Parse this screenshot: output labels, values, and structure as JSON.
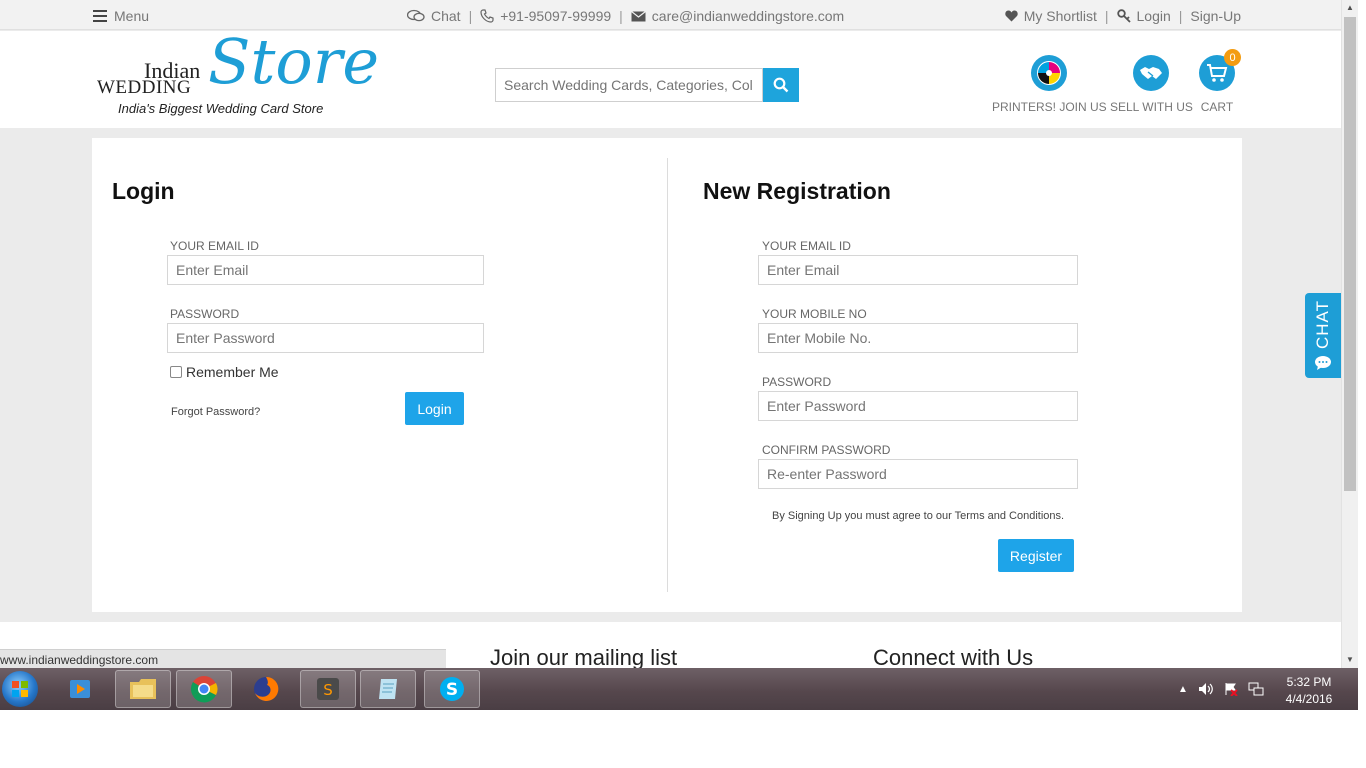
{
  "topbar": {
    "menu_label": "Menu",
    "chat_label": "Chat",
    "phone": "+91-95097-99999",
    "email": "care@indianweddingstore.com",
    "shortlist_label": "My Shortlist",
    "login_label": "Login",
    "signup_label": "Sign-Up",
    "separator": "|"
  },
  "header": {
    "logo": {
      "word1": "Indian",
      "word2": "WEDDING",
      "word3": "Store",
      "tagline": "India's Biggest Wedding Card Store"
    },
    "search": {
      "placeholder": "Search Wedding Cards, Categories, Col"
    },
    "actions": [
      {
        "label": "PRINTERS! JOIN US",
        "icon": "printer-colors-icon"
      },
      {
        "label": "SELL WITH US",
        "icon": "handshake-icon"
      },
      {
        "label": "CART",
        "icon": "cart-icon",
        "badge": "0"
      }
    ]
  },
  "login": {
    "title": "Login",
    "email_label": "YOUR EMAIL ID",
    "email_placeholder": "Enter Email",
    "password_label": "PASSWORD",
    "password_placeholder": "Enter Password",
    "remember_label": "Remember Me",
    "forgot_label": "Forgot Password?",
    "submit_label": "Login"
  },
  "register": {
    "title": "New Registration",
    "email_label": "YOUR EMAIL ID",
    "email_placeholder": "Enter Email",
    "mobile_label": "YOUR MOBILE NO",
    "mobile_placeholder": "Enter Mobile No.",
    "password_label": "PASSWORD",
    "password_placeholder": "Enter Password",
    "confirm_label": "CONFIRM PASSWORD",
    "confirm_placeholder": "Re-enter Password",
    "terms_text": "By Signing Up you must agree to our Terms and Conditions.",
    "submit_label": "Register"
  },
  "footer": {
    "mailing_label": "Join our mailing list",
    "connect_label": "Connect with Us"
  },
  "status_url": "www.indianweddingstore.com",
  "chat_tab_label": "CHAT",
  "taskbar": {
    "apps": [
      "media-player-icon",
      "file-explorer-icon",
      "chrome-icon",
      "firefox-icon",
      "sublime-text-icon",
      "notepad-icon",
      "skype-icon"
    ],
    "time": "5:32 PM",
    "date": "4/4/2016"
  },
  "colors": {
    "accent": "#1e9ed6",
    "button": "#1ea4e9",
    "page_bg": "#ebebeb",
    "cart_badge": "#f39c12"
  }
}
